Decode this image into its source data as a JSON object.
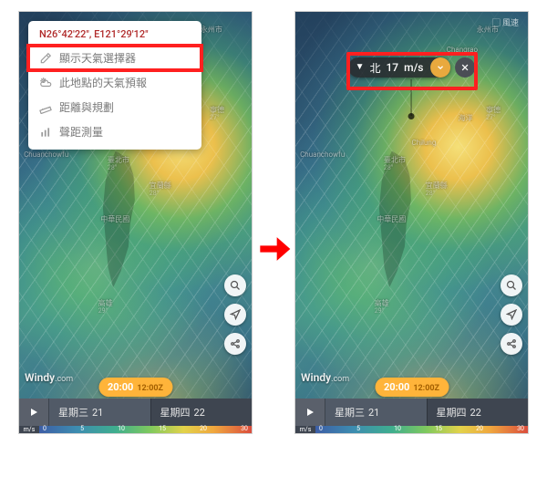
{
  "left": {
    "ctx": {
      "coords": "N26°42'22\", E121°29'12\"",
      "items": [
        {
          "icon": "dropper-icon",
          "label": "顯示天氣選擇器",
          "highlighted": true
        },
        {
          "icon": "sun-cloud-icon",
          "label": "此地點的天氣預報",
          "highlighted": false
        },
        {
          "icon": "ruler-icon",
          "label": "距離與規劃",
          "highlighted": false
        },
        {
          "icon": "bars-icon",
          "label": "聲距測量",
          "highlighted": false
        }
      ]
    }
  },
  "right": {
    "topright_label": "風速",
    "picker": {
      "direction_glyph": "▼",
      "direction_label": "北",
      "value": "17",
      "unit": "m/s"
    }
  },
  "shared": {
    "watermark_main": "Windy",
    "watermark_sub": ".com",
    "time_pill": {
      "local": "20:00",
      "z": "12:00Z"
    },
    "days": [
      {
        "name": "星期三",
        "num": "21"
      },
      {
        "name": "星期四",
        "num": "22"
      }
    ],
    "scale_unit": "m/s",
    "scale_ticks": [
      "0",
      "5",
      "10",
      "15",
      "20",
      "30"
    ],
    "map_labels": [
      {
        "text": "Chuanchowfu",
        "left": "2%",
        "top": "33%"
      },
      {
        "text": "臺北市",
        "left": "38%",
        "top": "34%",
        "temp": "28°"
      },
      {
        "text": "宜蘭縣",
        "left": "56%",
        "top": "40%",
        "temp": "28°"
      },
      {
        "text": "中華民國",
        "left": "35%",
        "top": "48%"
      },
      {
        "text": "高雄",
        "left": "34%",
        "top": "68%",
        "temp": "29°"
      },
      {
        "text": "寧德",
        "left": "82%",
        "top": "22%",
        "temp": "27°"
      },
      {
        "text": "海洋",
        "left": "70%",
        "top": "24%"
      },
      {
        "text": "Chilung",
        "left": "50%",
        "top": "30%"
      },
      {
        "text": "Changrao",
        "left": "65%",
        "top": "8%"
      },
      {
        "text": "永州市",
        "left": "78%",
        "top": "3%"
      }
    ],
    "buttons": {
      "search": "search-icon",
      "locate": "locate-icon",
      "share": "share-icon"
    }
  }
}
